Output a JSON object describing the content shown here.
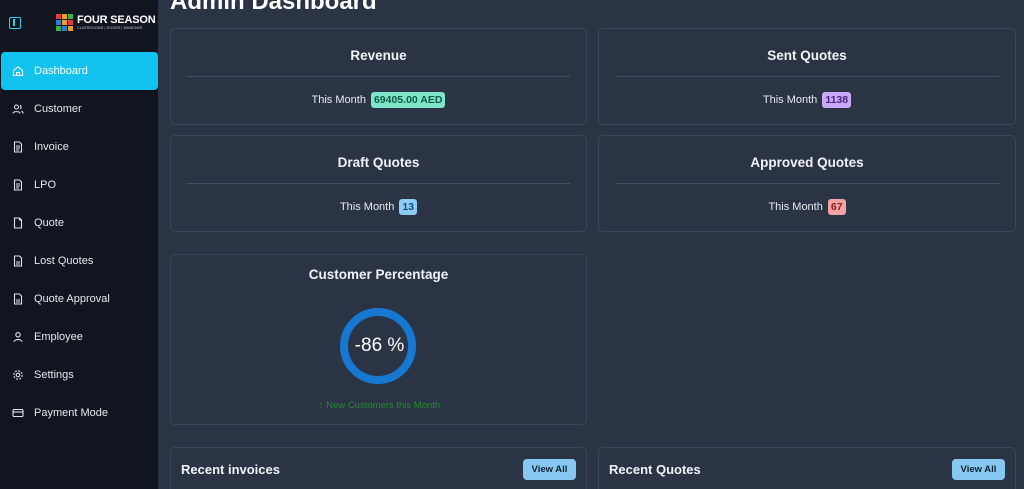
{
  "app": {
    "logo_title": "FOUR SEASON",
    "logo_subtitle": "CLASSROOMS | DOORS | WINDOWS",
    "page_title": "Admin Dashboard"
  },
  "sidebar": {
    "toggle_icon": "sidebar-toggle-icon",
    "items": [
      {
        "label": "Dashboard",
        "icon": "home-icon",
        "active": true
      },
      {
        "label": "Customer",
        "icon": "users-icon"
      },
      {
        "label": "Invoice",
        "icon": "document-icon"
      },
      {
        "label": "LPO",
        "icon": "document-icon"
      },
      {
        "label": "Quote",
        "icon": "file-icon"
      },
      {
        "label": "Lost Quotes",
        "icon": "file-text-icon"
      },
      {
        "label": "Quote Approval",
        "icon": "file-text-icon"
      },
      {
        "label": "Employee",
        "icon": "user-icon"
      },
      {
        "label": "Settings",
        "icon": "gear-icon"
      },
      {
        "label": "Payment Mode",
        "icon": "credit-card-icon"
      }
    ]
  },
  "cards": {
    "revenue": {
      "title": "Revenue",
      "period": "This Month",
      "value": "69405.00 AED",
      "badge_bg": "#7ee6c8",
      "badge_fg": "#0d5a45"
    },
    "sent": {
      "title": "Sent Quotes",
      "period": "This Month",
      "value": "1138",
      "badge_bg": "#c9a8f5",
      "badge_fg": "#4a2480"
    },
    "draft": {
      "title": "Draft Quotes",
      "period": "This Month",
      "value": "13",
      "badge_bg": "#8ccbf7",
      "badge_fg": "#164d7a"
    },
    "approved": {
      "title": "Approved Quotes",
      "period": "This Month",
      "value": "67",
      "badge_bg": "#f4a3a3",
      "badge_fg": "#8a1e1e"
    }
  },
  "customer_percentage": {
    "title": "Customer Percentage",
    "value_label": "-86 %",
    "subtext": "New Customers this Month",
    "arrow_icon": "arrow-up-icon",
    "ring_color": "#1778d2",
    "fill_fraction": 1.0
  },
  "recent": {
    "invoices_title": "Recent invoices",
    "quotes_title": "Recent Quotes",
    "view_all_label": "View All"
  }
}
